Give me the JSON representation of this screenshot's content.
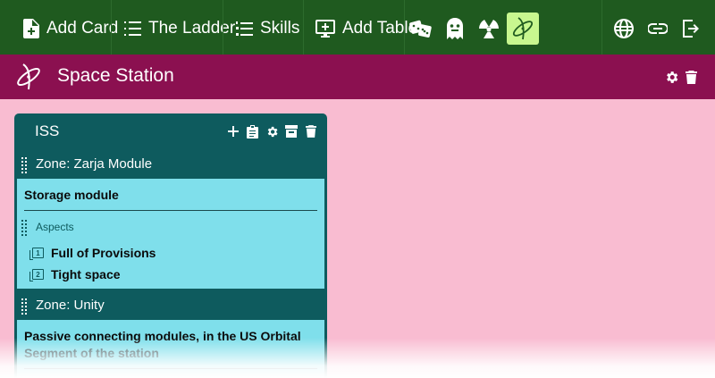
{
  "nav": {
    "add_card": "Add Card",
    "the_ladder": "The Ladder",
    "skills": "Skills",
    "add_table": "Add Table",
    "icons": [
      "dice-icon",
      "ghost-icon",
      "radiation-icon",
      "atom-icon"
    ],
    "right_icons": [
      "globe-icon",
      "link-icon",
      "logout-icon"
    ]
  },
  "table": {
    "title": "Space Station"
  },
  "card": {
    "title": "ISS",
    "zones": [
      {
        "label": "Zone: Zarja Module",
        "description": "Storage module",
        "aspects_label": "Aspects",
        "aspects": [
          {
            "badge": "1",
            "text": "Full of Provisions"
          },
          {
            "badge": "2",
            "text": "Tight space"
          }
        ]
      },
      {
        "label": "Zone: Unity",
        "description_line1": "Passive connecting modules, in the US Orbital",
        "description_line2": "Segment of the station"
      }
    ]
  },
  "colors": {
    "nav_bg": "#1f5a1f",
    "table_bar_bg": "#8b1050",
    "page_bg": "#f9bcd1",
    "card_bg": "#0e5b5e",
    "zone_bg": "#7fdfeb",
    "active_icon_bg": "#c8f78f"
  }
}
